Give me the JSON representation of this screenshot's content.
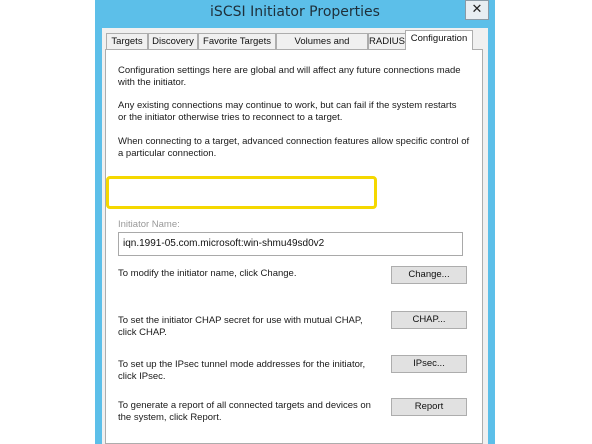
{
  "window": {
    "title": "iSCSI Initiator Properties",
    "close_glyph": "✕"
  },
  "tabs": [
    {
      "label": "Targets"
    },
    {
      "label": "Discovery"
    },
    {
      "label": "Favorite Targets"
    },
    {
      "label": "Volumes and Devices"
    },
    {
      "label": "RADIUS"
    },
    {
      "label": "Configuration"
    }
  ],
  "config": {
    "intro1": "Configuration settings here are global and will affect any future connections made with the initiator.",
    "intro2": "Any existing connections may continue to work, but can fail if the system restarts or the initiator otherwise tries to reconnect to a target.",
    "intro3": "When connecting to a target, advanced connection features allow specific control of a particular connection.",
    "initiator_label": "Initiator Name:",
    "initiator_name": "iqn.1991-05.com.microsoft:win-shmu49sd0v2",
    "change_text": "To modify the initiator name, click Change.",
    "change_btn": "Change...",
    "chap_text": "To set the initiator CHAP secret for use with mutual CHAP, click CHAP.",
    "chap_btn": "CHAP...",
    "ipsec_text": "To set up the IPsec tunnel mode addresses for the initiator, click IPsec.",
    "ipsec_btn": "IPsec...",
    "report_text": "To generate a report of all connected targets and devices on the system, click Report.",
    "report_btn": "Report"
  },
  "colors": {
    "titlebar": "#5cbfe9",
    "highlight": "#f5d800"
  }
}
